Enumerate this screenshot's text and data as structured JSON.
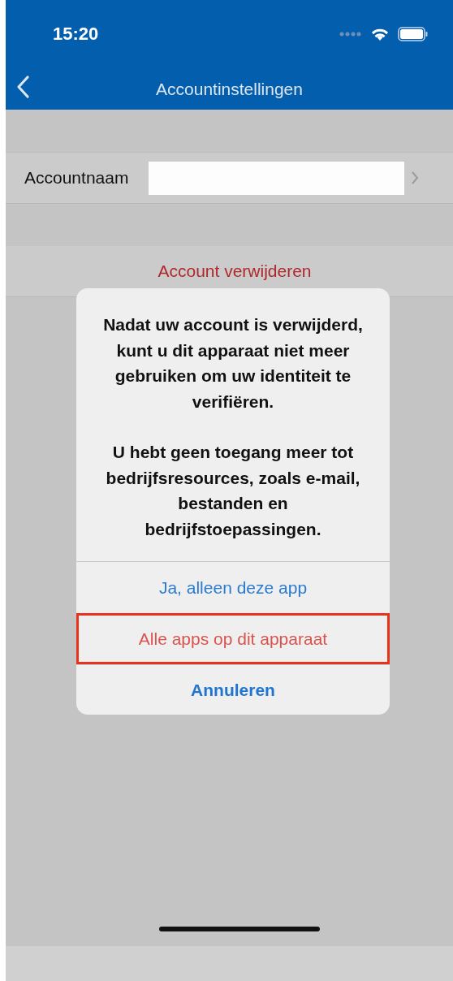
{
  "status_bar": {
    "time": "15:20"
  },
  "nav_bar": {
    "title": "Accountinstellingen"
  },
  "settings": [
    {
      "kind": "detail",
      "label": "Accountnaam",
      "redacted": true
    },
    {
      "kind": "destructive",
      "label": "Account verwijderen"
    }
  ],
  "alert": {
    "message": [
      "Nadat uw account is verwijderd, kunt u dit apparaat niet meer gebruiken om uw identiteit te verifiëren.",
      "U hebt geen toegang meer tot bedrijfsresources, zoals e-mail, bestanden en bedrijfstoepassingen."
    ],
    "actions": [
      {
        "kind": "default",
        "label": "Ja, alleen deze app",
        "highlighted": false
      },
      {
        "kind": "destructive",
        "label": "Alle apps op dit apparaat",
        "highlighted": true
      },
      {
        "kind": "cancel",
        "label": "Annuleren",
        "highlighted": false
      }
    ]
  }
}
